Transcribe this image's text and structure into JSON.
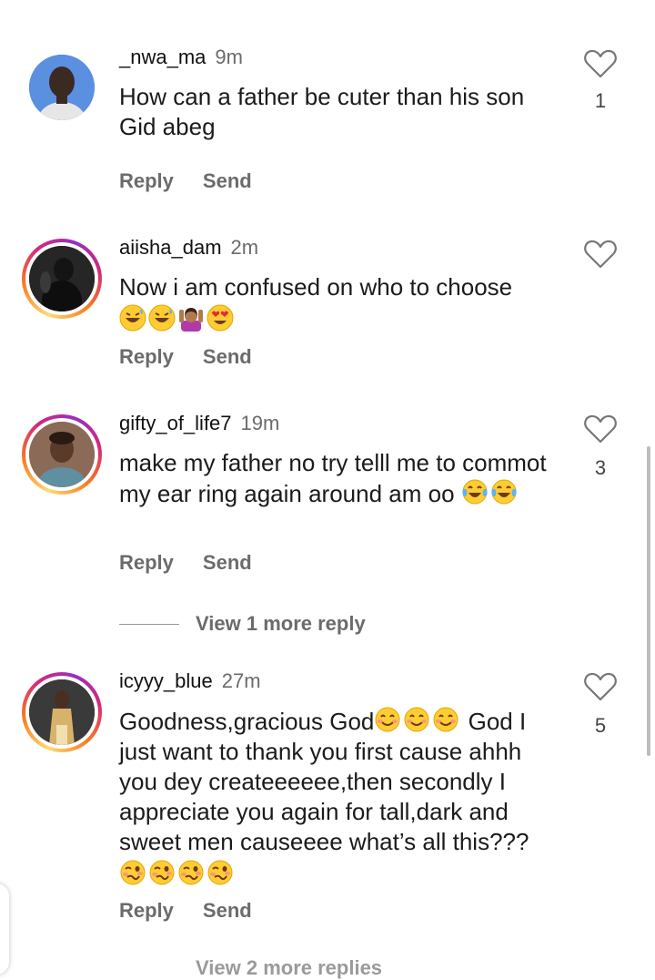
{
  "comments": [
    {
      "username": "_nwa_ma",
      "time": "9m",
      "text": "How can a father be cuter than his son\n Gid abeg",
      "emojis": [],
      "likes": "1",
      "reply_label": "Reply",
      "send_label": "Send"
    },
    {
      "username": "aiisha_dam",
      "time": "2m",
      "text": "Now i am confused on who to choose",
      "emojis": [
        "grinning-sweat-emoji",
        "grinning-sweat-emoji",
        "person-raising-hands-emoji",
        "heart-eyes-emoji"
      ],
      "likes": "",
      "reply_label": "Reply",
      "send_label": "Send"
    },
    {
      "username": "gifty_of_life7",
      "time": "19m",
      "text": "make my father no try telll me to commot my ear ring again around am oo",
      "emojis": [
        "tears-of-joy-emoji",
        "tears-of-joy-emoji"
      ],
      "likes": "3",
      "reply_label": "Reply",
      "send_label": "Send"
    },
    {
      "username": "icyyy_blue",
      "time": "27m",
      "text": "Goodness,gracious God",
      "text2": " God I just want to thank you first cause ahhh you dey createeeeee,then secondly I appreciate you again for tall,dark and sweet men causeeee what’s all this???",
      "emojis_inline": [
        "smiling-blush-emoji",
        "smiling-blush-emoji",
        "smiling-blush-emoji"
      ],
      "emojis": [
        "woozy-face-emoji",
        "woozy-face-emoji",
        "woozy-face-emoji",
        "woozy-face-emoji"
      ],
      "likes": "5",
      "reply_label": "Reply",
      "send_label": "Send"
    }
  ],
  "view_more_replies": "View 1 more reply",
  "cut_off_text": "View 2 more replies",
  "colors": {
    "story_ring": "#d62976",
    "meta_gray": "#6b6b6b"
  }
}
